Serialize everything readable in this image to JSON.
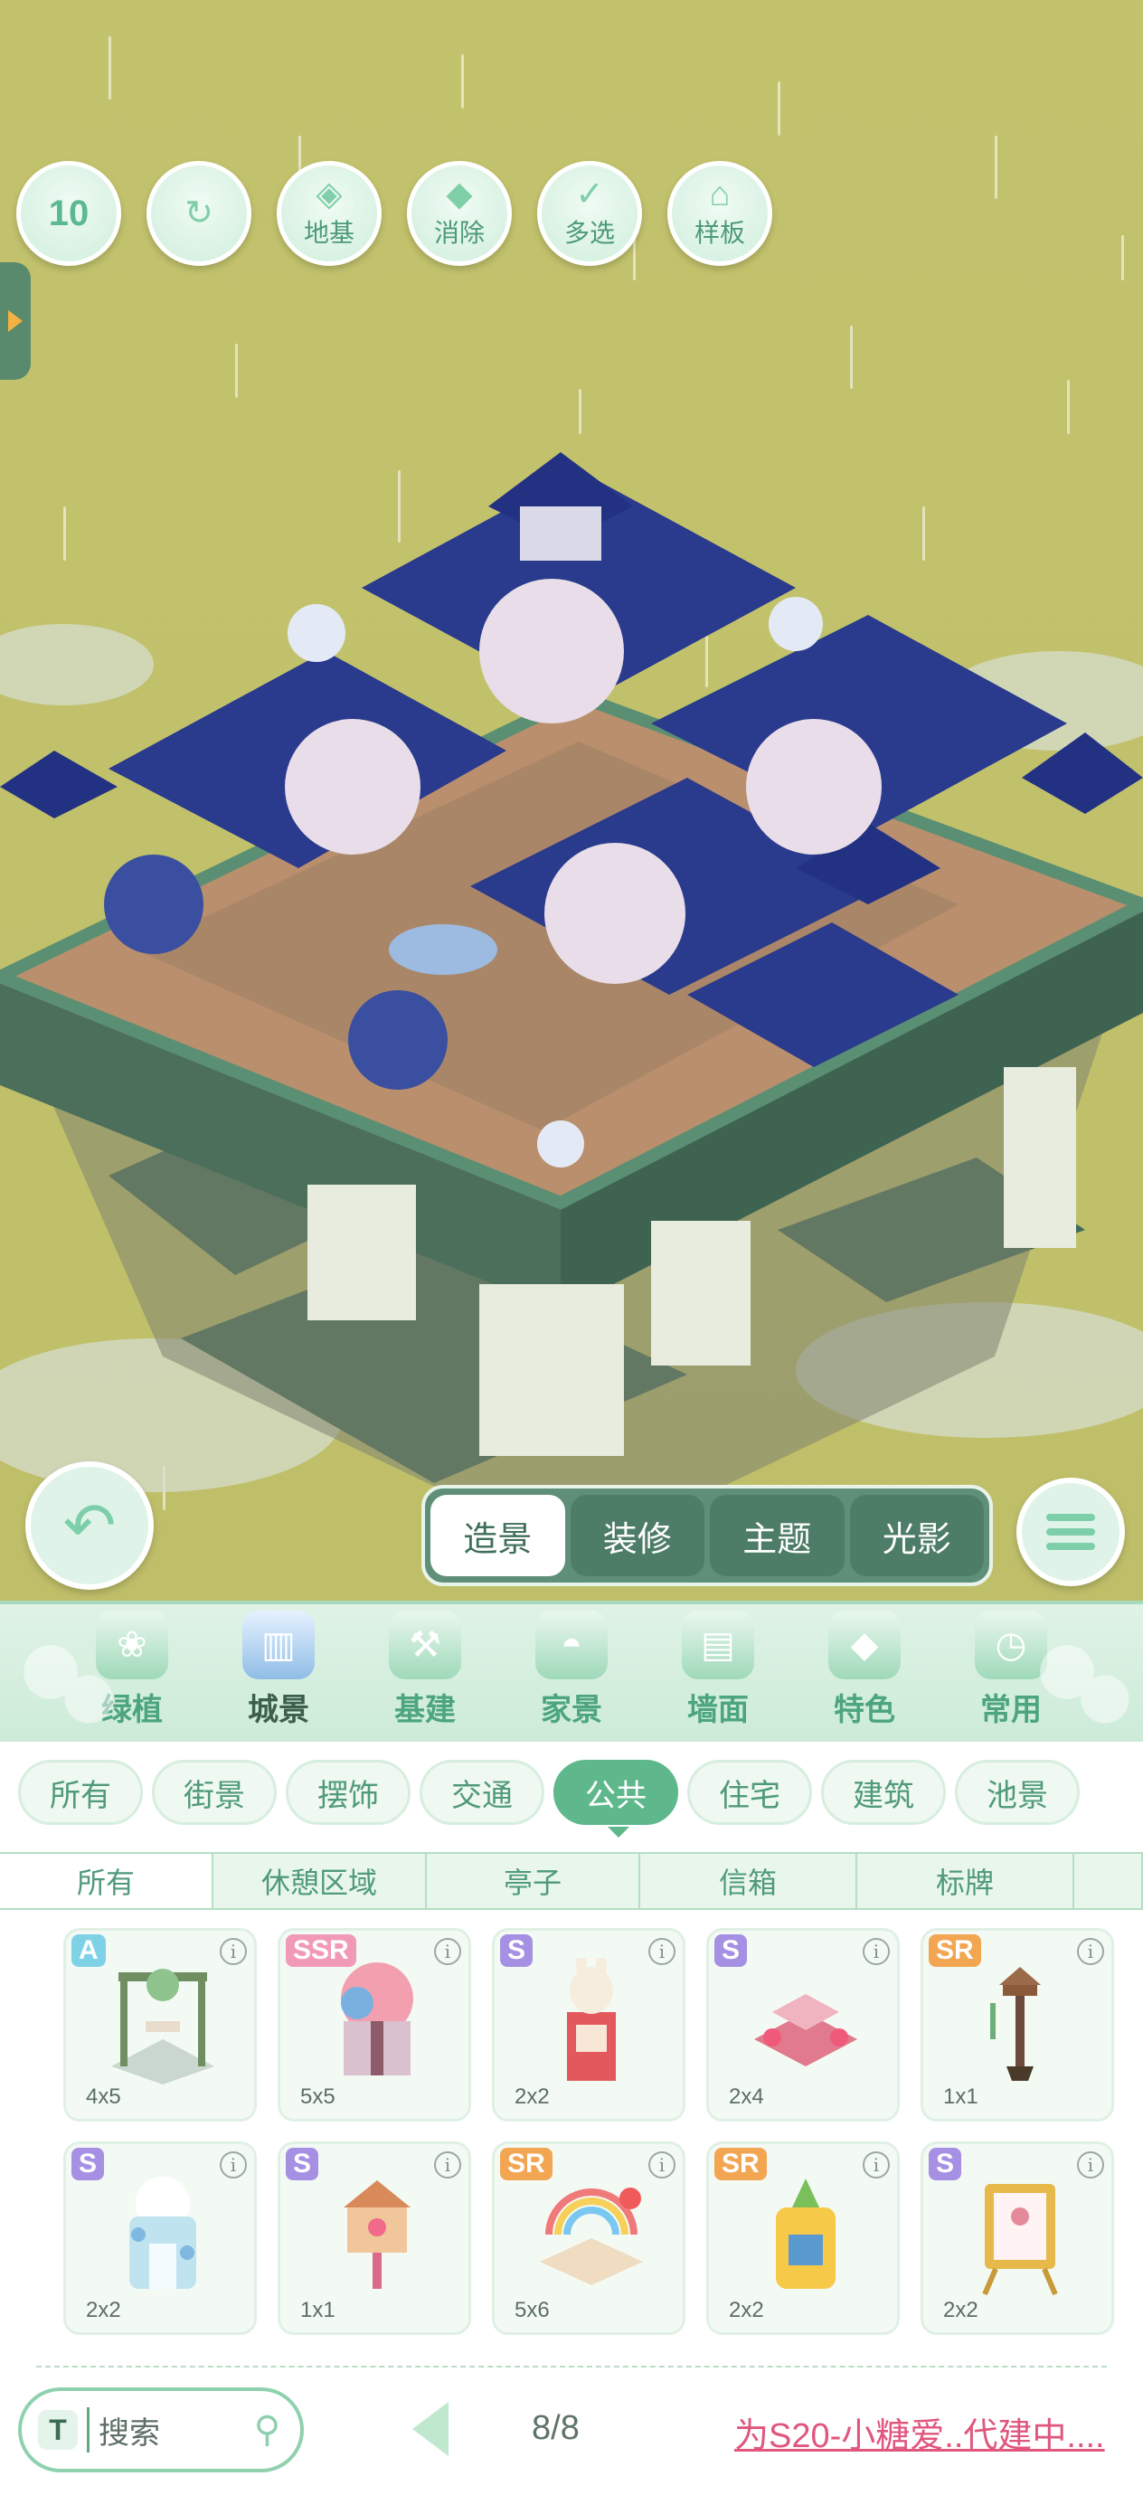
{
  "toolbar": {
    "undo_count": "10",
    "buttons": [
      {
        "id": "undo",
        "icon": "undo-icon",
        "label": ""
      },
      {
        "id": "redo",
        "icon": "redo-icon",
        "label": ""
      },
      {
        "id": "foundation",
        "icon": "foundation-icon",
        "label": "地基"
      },
      {
        "id": "erase",
        "icon": "eraser-icon",
        "label": "消除"
      },
      {
        "id": "multiselect",
        "icon": "multiselect-icon",
        "label": "多选"
      },
      {
        "id": "template",
        "icon": "template-icon",
        "label": "样板"
      }
    ]
  },
  "mode_tabs": [
    {
      "label": "造景",
      "active": true
    },
    {
      "label": "装修",
      "active": false
    },
    {
      "label": "主题",
      "active": false
    },
    {
      "label": "光影",
      "active": false
    }
  ],
  "categories": [
    {
      "label": "绿植",
      "icon": "plant-icon",
      "active": false
    },
    {
      "label": "城景",
      "icon": "city-icon",
      "active": true
    },
    {
      "label": "基建",
      "icon": "construction-icon",
      "active": false
    },
    {
      "label": "家景",
      "icon": "home-icon",
      "active": false
    },
    {
      "label": "墙面",
      "icon": "wall-icon",
      "active": false
    },
    {
      "label": "特色",
      "icon": "feature-icon",
      "active": false
    },
    {
      "label": "常用",
      "icon": "recent-icon",
      "active": false
    }
  ],
  "filters": [
    {
      "label": "所有",
      "active": false
    },
    {
      "label": "街景",
      "active": false
    },
    {
      "label": "摆饰",
      "active": false
    },
    {
      "label": "交通",
      "active": false
    },
    {
      "label": "公共",
      "active": true
    },
    {
      "label": "住宅",
      "active": false
    },
    {
      "label": "建筑",
      "active": false
    },
    {
      "label": "池景",
      "active": false
    }
  ],
  "subtabs": [
    {
      "label": "所有",
      "active": true
    },
    {
      "label": "休憩区域",
      "active": false
    },
    {
      "label": "亭子",
      "active": false
    },
    {
      "label": "信箱",
      "active": false
    },
    {
      "label": "标牌",
      "active": false
    }
  ],
  "items": [
    {
      "rarity": "A",
      "size": "4x5",
      "icon": "vine-swing-icon",
      "color": "#7fd2e6"
    },
    {
      "rarity": "SSR",
      "size": "5x5",
      "icon": "rose-pavilion-icon",
      "color": "#f19ab7"
    },
    {
      "rarity": "S",
      "size": "2x2",
      "icon": "bunny-booth-icon",
      "color": "#a590e3"
    },
    {
      "rarity": "S",
      "size": "2x4",
      "icon": "rose-bench-icon",
      "color": "#a590e3"
    },
    {
      "rarity": "SR",
      "size": "1x1",
      "icon": "lantern-post-icon",
      "color": "#f2a652"
    },
    {
      "rarity": "S",
      "size": "2x2",
      "icon": "cloud-arch-icon",
      "color": "#a590e3"
    },
    {
      "rarity": "S",
      "size": "1x1",
      "icon": "candy-mailbox-icon",
      "color": "#a590e3"
    },
    {
      "rarity": "SR",
      "size": "5x6",
      "icon": "rainbow-stall-icon",
      "color": "#f2a652"
    },
    {
      "rarity": "SR",
      "size": "2x2",
      "icon": "pineapple-kiosk-icon",
      "color": "#f2a652"
    },
    {
      "rarity": "S",
      "size": "2x2",
      "icon": "easel-sign-icon",
      "color": "#a590e3"
    }
  ],
  "search": {
    "placeholder": "搜索"
  },
  "pager": {
    "text": "8/8"
  },
  "promo": {
    "text": "为S20-小糖爱..代建中...."
  },
  "colors": {
    "accent": "#5fb88c",
    "background": "#c2c26f",
    "promo": "#e0567c"
  }
}
